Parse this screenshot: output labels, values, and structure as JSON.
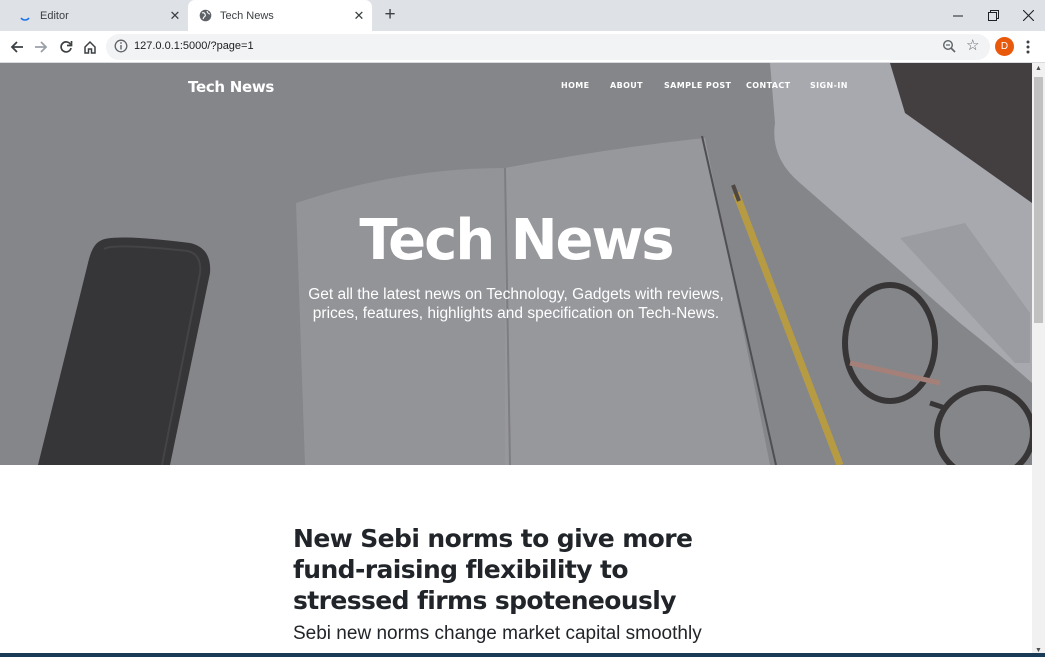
{
  "browser": {
    "tabs": [
      {
        "title": "Editor",
        "icon": "loading-spinner-icon",
        "active": false
      },
      {
        "title": "Tech News",
        "icon": "globe-icon",
        "active": true
      }
    ],
    "address": "127.0.0.1:5000/?page=1",
    "profile_initial": "D",
    "accent": "#e8590c"
  },
  "site": {
    "brand": "Tech News",
    "nav": [
      "HOME",
      "ABOUT",
      "SAMPLE POST",
      "CONTACT",
      "SIGN-IN"
    ],
    "hero": {
      "title": "Tech News",
      "subtitle": "Get all the latest news on Technology, Gadgets with reviews, prices, features, highlights and specification on Tech-News."
    },
    "post": {
      "title": "New Sebi norms to give more fund-raising flexibility to stressed firms spoteneously",
      "subtitle": "Sebi new norms change market capital smoothly"
    }
  }
}
